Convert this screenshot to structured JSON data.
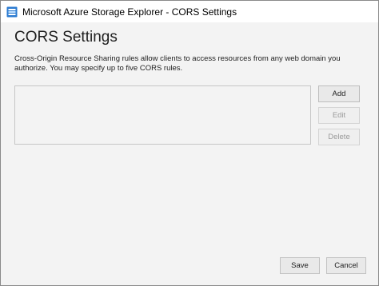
{
  "window": {
    "title": "Microsoft Azure Storage Explorer - CORS Settings",
    "icon": "azure-storage-explorer-icon"
  },
  "dialog": {
    "heading": "CORS Settings",
    "description": "Cross-Origin Resource Sharing rules allow clients to access resources from any web domain you authorize. You may specify up to five CORS rules.",
    "rules": []
  },
  "side_buttons": {
    "add": {
      "label": "Add",
      "enabled": true
    },
    "edit": {
      "label": "Edit",
      "enabled": false
    },
    "delete": {
      "label": "Delete",
      "enabled": false
    }
  },
  "footer": {
    "save_label": "Save",
    "cancel_label": "Cancel"
  },
  "colors": {
    "icon_blue": "#2b7bd1",
    "window_bg": "#f3f3f3",
    "disabled_text": "#9a9a9a"
  }
}
